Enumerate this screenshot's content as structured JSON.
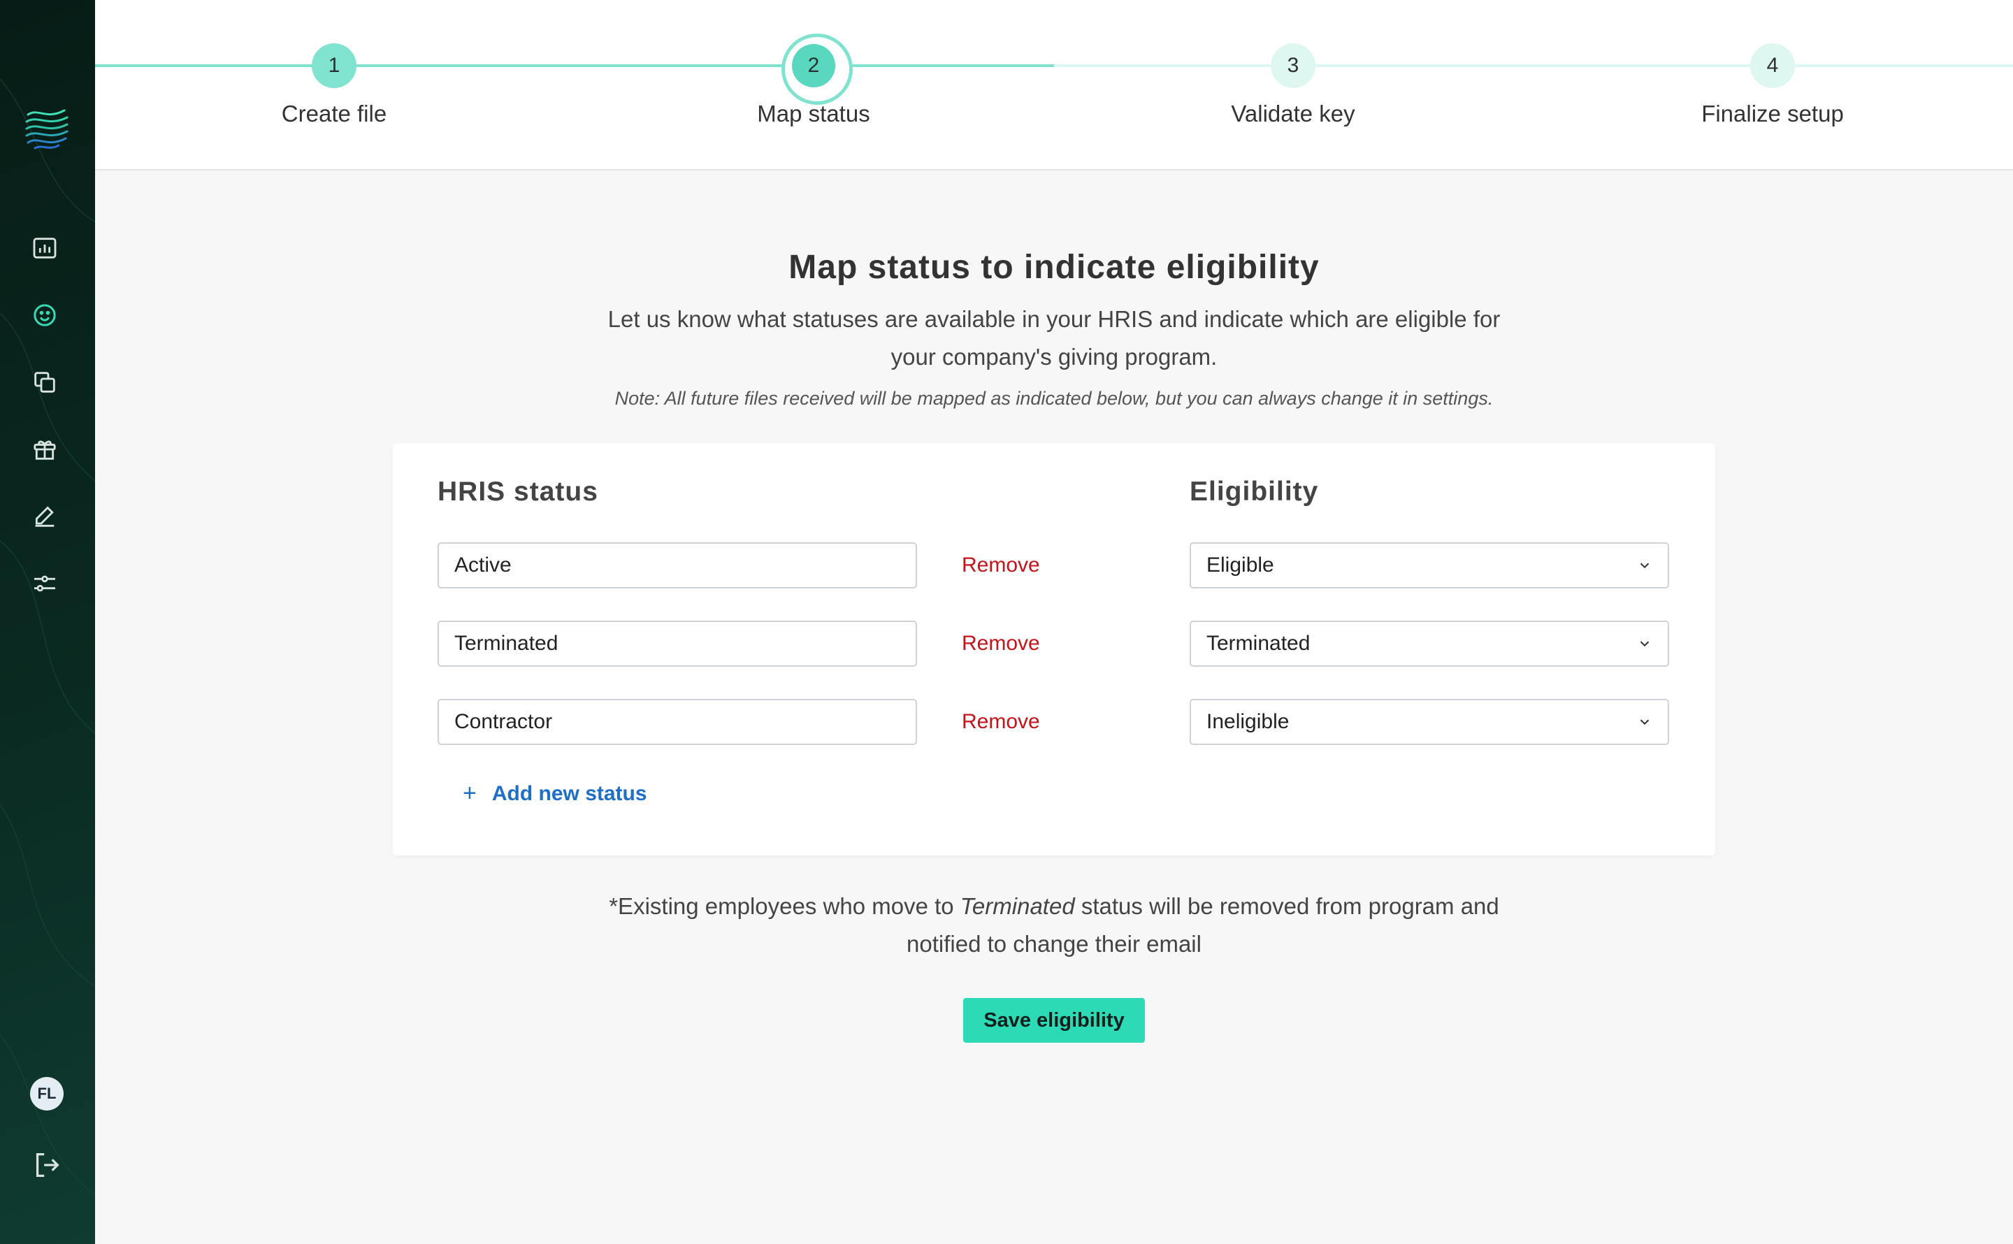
{
  "stepper": {
    "steps": [
      {
        "number": "1",
        "label": "Create file",
        "state": "completed"
      },
      {
        "number": "2",
        "label": "Map status",
        "state": "active"
      },
      {
        "number": "3",
        "label": "Validate key",
        "state": "pending"
      },
      {
        "number": "4",
        "label": "Finalize setup",
        "state": "pending"
      }
    ]
  },
  "sidebar": {
    "items": [
      {
        "icon": "bar-chart-icon"
      },
      {
        "icon": "smiley-icon",
        "active": true
      },
      {
        "icon": "copy-icon"
      },
      {
        "icon": "gift-icon"
      },
      {
        "icon": "pencil-icon"
      },
      {
        "icon": "sliders-icon"
      }
    ],
    "avatar_initials": "FL",
    "logout_icon": "logout-icon"
  },
  "main": {
    "title": "Map status to indicate eligibility",
    "intro": "Let us know what statuses are available in your HRIS and indicate which are eligible for your company's giving program.",
    "note": "Note: All future files received will be mapped as indicated below, but you can always change it in settings.",
    "table": {
      "hris_header": "HRIS status",
      "eligibility_header": "Eligibility",
      "remove_label": "Remove",
      "rows": [
        {
          "status": "Active",
          "eligibility": "Eligible"
        },
        {
          "status": "Terminated",
          "eligibility": "Terminated"
        },
        {
          "status": "Contractor",
          "eligibility": "Ineligible"
        }
      ],
      "add_label": "Add new status"
    },
    "footnote": {
      "prefix": "*Existing employees who move to ",
      "emphasis": "Terminated",
      "suffix": " status will be removed from program and notified to change their email"
    },
    "save_label": "Save eligibility"
  },
  "colors": {
    "accent": "#2cdbb6",
    "step_done": "#7fe3cf",
    "remove": "#c4141b",
    "link": "#1e6fc7",
    "sidebar_bg": "#0a2a21"
  }
}
